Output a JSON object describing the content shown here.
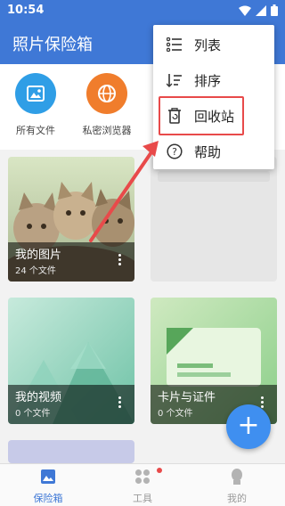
{
  "status_bar": {
    "time": "10:54"
  },
  "app_bar": {
    "title": "照片保险箱",
    "more_icon": "more-vert-icon"
  },
  "quick_actions": [
    {
      "label": "所有文件",
      "icon": "image-icon",
      "color": "#2f9ee6"
    },
    {
      "label": "私密浏览器",
      "icon": "globe-icon",
      "color": "#f07d2c"
    }
  ],
  "albums": [
    {
      "name": "我的图片",
      "count": "24 个文件"
    },
    {
      "name": "我的视频",
      "count": "0 个文件"
    },
    {
      "name": "卡片与证件",
      "count": "0 个文件"
    }
  ],
  "menu": {
    "items": [
      {
        "label": "列表",
        "icon": "list-icon"
      },
      {
        "label": "排序",
        "icon": "sort-icon"
      },
      {
        "label": "回收站",
        "icon": "trash-icon"
      },
      {
        "label": "帮助",
        "icon": "help-icon"
      }
    ],
    "highlighted_item": "回收站"
  },
  "fab": {
    "label": "+"
  },
  "bottom_nav": [
    {
      "label": "保险箱",
      "active": true
    },
    {
      "label": "工具",
      "badge": true
    },
    {
      "label": "我的"
    }
  ],
  "colors": {
    "primary": "#3f78d6",
    "accent": "#3f8ff0",
    "highlight": "#e84a4a"
  }
}
